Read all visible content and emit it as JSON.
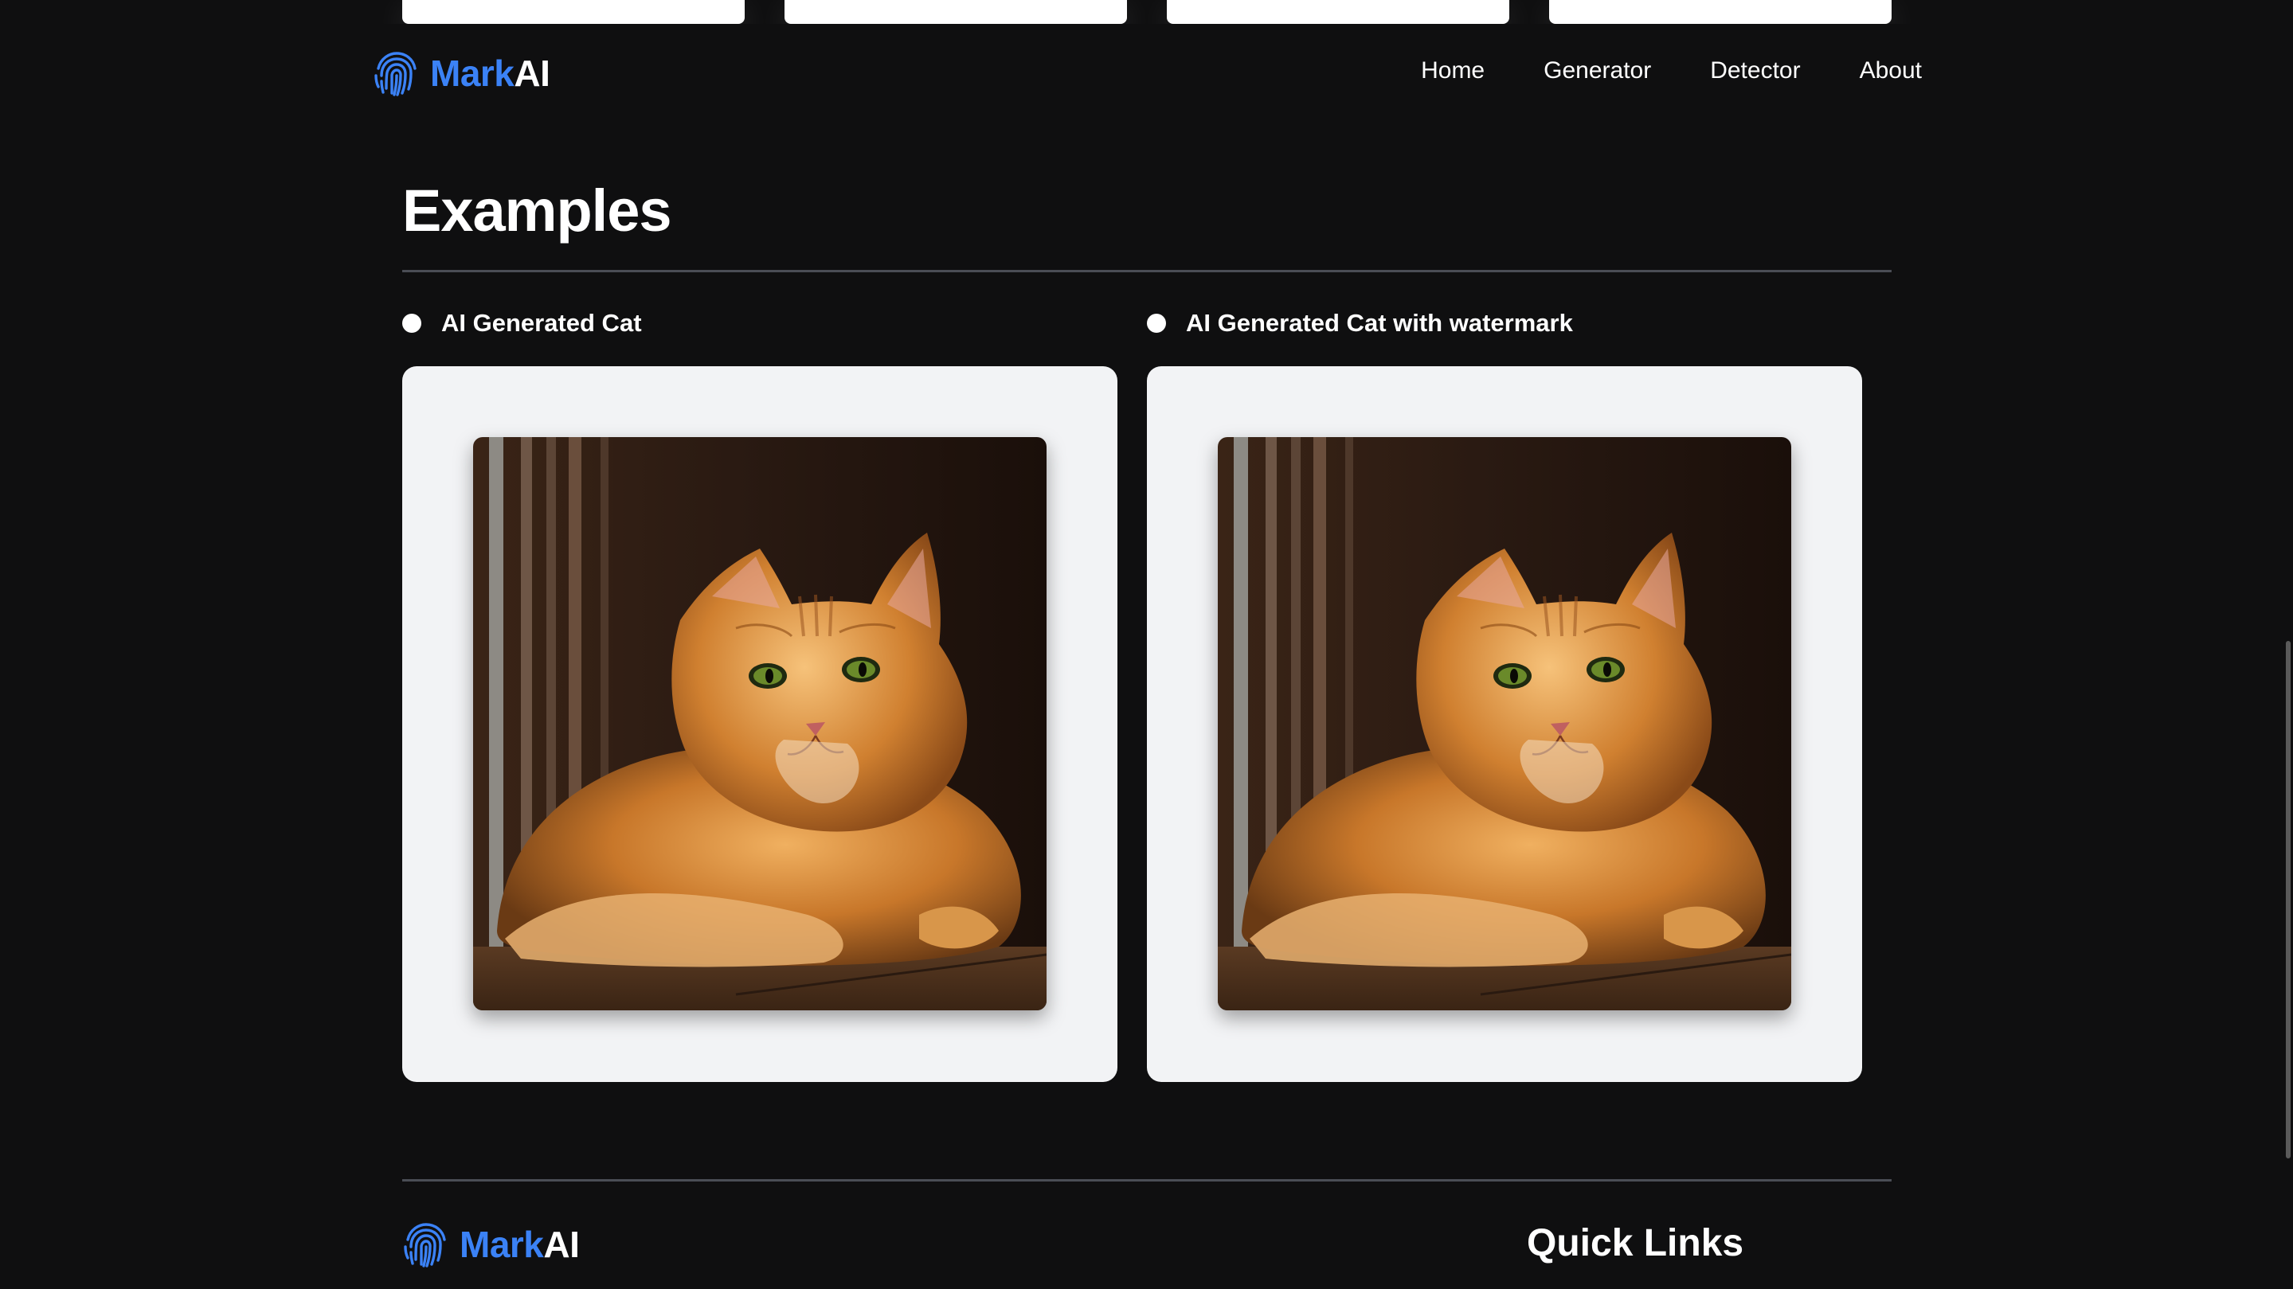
{
  "navbar": {
    "brand_mark": "Mark",
    "brand_ai": "AI",
    "links": [
      {
        "label": "Home"
      },
      {
        "label": "Generator"
      },
      {
        "label": "Detector"
      },
      {
        "label": "About"
      }
    ]
  },
  "examples": {
    "title": "Examples",
    "items": [
      {
        "label": "AI Generated Cat",
        "image_subject": "orange-cat"
      },
      {
        "label": "AI Generated Cat with watermark",
        "image_subject": "orange-cat"
      }
    ]
  },
  "footer": {
    "brand_mark": "Mark",
    "brand_ai": "AI",
    "quick_links_title": "Quick Links"
  },
  "colors": {
    "background": "#0f0f10",
    "accent": "#3b82f6",
    "card": "#f2f3f5",
    "divider": "#4a4d55"
  },
  "icons": {
    "brand_logo": "fingerprint-icon",
    "list_bullet": "bullet-dot-icon"
  }
}
